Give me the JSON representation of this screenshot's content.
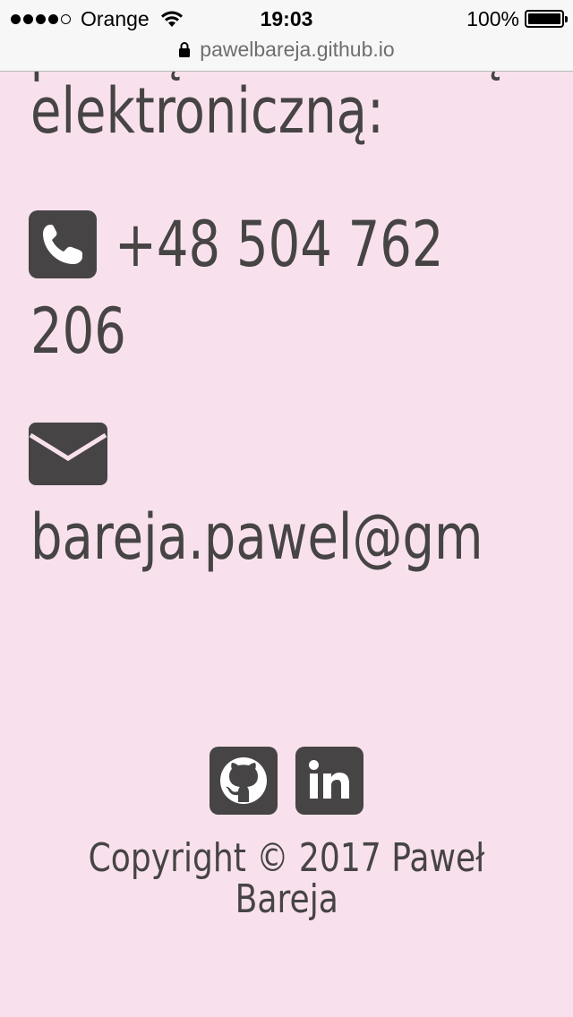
{
  "status_bar": {
    "carrier": "Orange",
    "time": "19:03",
    "battery_percent": "100%",
    "battery_level": 1.0,
    "signal_bars_filled": 4,
    "signal_bars_total": 5,
    "url": "pawelbareja.github.io"
  },
  "contact": {
    "cut_off_prefix": "pocztą elektroniczną:",
    "heading_end": "elektroniczną:",
    "phone_part1": "+48 504 762",
    "phone_part2": "206",
    "email_visible": "bareja.pawel@gm"
  },
  "footer": {
    "social": [
      {
        "name": "github-icon"
      },
      {
        "name": "linkedin-icon"
      }
    ],
    "copyright_line1": "Copyright © 2017 Paweł",
    "copyright_line2": "Bareja"
  },
  "colors": {
    "background": "#f8e1ec",
    "text": "#464444",
    "statusbar_bg": "#f7f7f7",
    "url_text": "#6e6e6e"
  }
}
